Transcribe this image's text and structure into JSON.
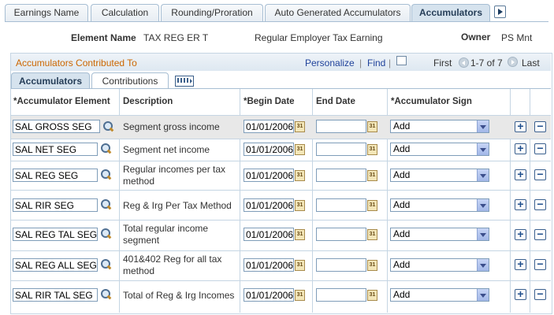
{
  "tabs": [
    {
      "label": "Earnings Name"
    },
    {
      "label": "Calculation"
    },
    {
      "label": "Rounding/Proration"
    },
    {
      "label": "Auto Generated Accumulators"
    },
    {
      "label": "Accumulators"
    }
  ],
  "element": {
    "name_label": "Element Name",
    "name_value": "TAX REG ER T",
    "description": "Regular Employer Tax Earning",
    "owner_label": "Owner",
    "owner_value": "PS Mnt"
  },
  "grid": {
    "title": "Accumulators Contributed To",
    "personalize": "Personalize",
    "find": "Find",
    "first": "First",
    "range": "1-7 of 7",
    "last": "Last",
    "subtabs": [
      "Accumulators",
      "Contributions"
    ],
    "columns": {
      "accumulator_element": "*Accumulator Element",
      "description": "Description",
      "begin_date": "*Begin Date",
      "end_date": "End Date",
      "accumulator_sign": "*Accumulator Sign"
    },
    "rows": [
      {
        "element": "SAL GROSS SEG",
        "description": "Segment gross income",
        "begin": "01/01/2006",
        "end": "",
        "sign": "Add"
      },
      {
        "element": "SAL NET SEG",
        "description": "Segment net income",
        "begin": "01/01/2006",
        "end": "",
        "sign": "Add"
      },
      {
        "element": "SAL REG SEG",
        "description": "Regular incomes per tax method",
        "begin": "01/01/2006",
        "end": "",
        "sign": "Add"
      },
      {
        "element": "SAL RIR SEG",
        "description": "Reg & Irg Per Tax Method",
        "begin": "01/01/2006",
        "end": "",
        "sign": "Add"
      },
      {
        "element": "SAL REG TAL SEG",
        "description": "Total regular income segment",
        "begin": "01/01/2006",
        "end": "",
        "sign": "Add"
      },
      {
        "element": "SAL REG ALL SEG",
        "description": "401&402 Reg for all tax method",
        "begin": "01/01/2006",
        "end": "",
        "sign": "Add"
      },
      {
        "element": "SAL RIR TAL SEG",
        "description": "Total of Reg & Irg Incomes",
        "begin": "01/01/2006",
        "end": "",
        "sign": "Add"
      }
    ],
    "add_symbol": "+",
    "delete_symbol": "−",
    "calendar_glyph": "31"
  }
}
